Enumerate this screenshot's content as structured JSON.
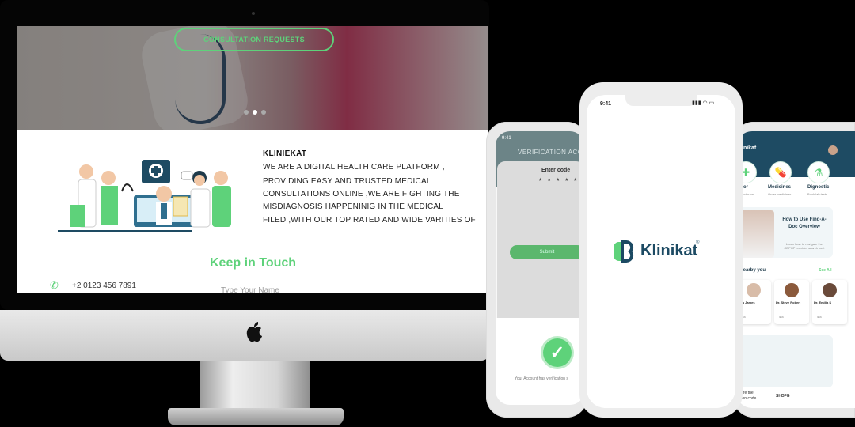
{
  "website": {
    "hero_button": "CONSULTATION REQUESTS",
    "about_title": "KLINIEKAT",
    "about_lines": [
      "WE ARE A DIGITAL HEALTH CARE PLATFORM ,",
      "PROVIDING EASY AND TRUSTED MEDICAL",
      "CONSULTATIONS ONLINE ,WE ARE FIGHTING THE",
      "MISDIAGNOSIS HAPPENINIG IN THE MEDICAL",
      "FILED ,WITH OUR TOP RATED AND WIDE VARITIES OF"
    ],
    "keep_in_touch": "Keep in Touch",
    "phone": "+2 0123 456 7891",
    "name_placeholder": "Type Your Name"
  },
  "phone_left": {
    "status_time": "9:41",
    "title": "VERIFICATION ACC",
    "enter_code": "Enter code",
    "stars": "★ ★ ★ ★ ★",
    "submit": "Submit",
    "verified_text": "Your Account has verification s"
  },
  "phone_mid": {
    "status_time": "9:41",
    "status_icons": "▮▮▮ ◠ ▭",
    "brand": "Klinikat",
    "reg": "®"
  },
  "phone_right": {
    "brand": "Klinikat",
    "services": [
      {
        "label": "octor",
        "sub": "ith doctor on"
      },
      {
        "label": "Medicines",
        "sub": "Order medicines"
      },
      {
        "label": "Dignostic",
        "sub": "Book lab tests"
      }
    ],
    "banner_title": "How to Use Find-A-Doc Overview",
    "banner_sub": "Learn how to navigate the CDPHP provider search tool.",
    "nearby": "s nearby you",
    "see_all": "See All",
    "doctors": [
      {
        "name": "Ewa James",
        "rate": "4.8"
      },
      {
        "name": "Dr. Steve Robert",
        "rate": "4.8"
      },
      {
        "name": "Dr. Emilia S",
        "rate": "4.8"
      }
    ],
    "share": "Share the\nGiven code",
    "share_code": "SHDFG"
  },
  "colors": {
    "accent_green": "#5ed27a",
    "navy": "#1e4b63"
  }
}
